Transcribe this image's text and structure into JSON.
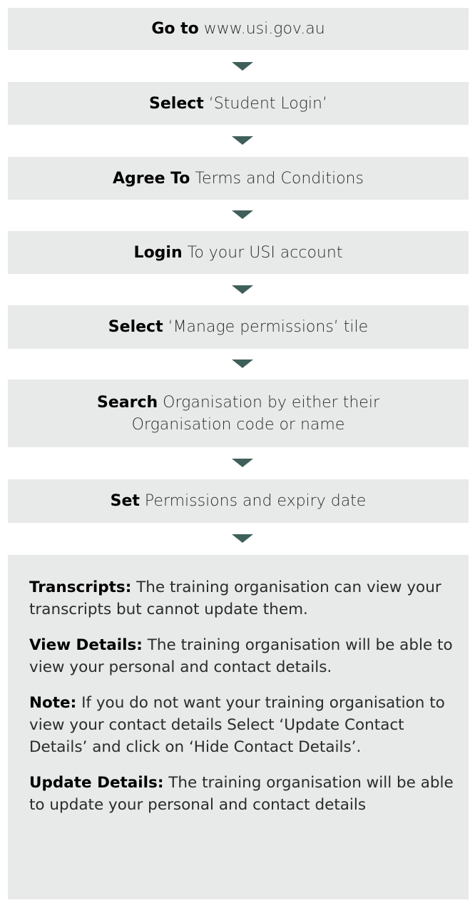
{
  "steps": [
    {
      "bold": "Go to",
      "rest": " www.usi.gov.au"
    },
    {
      "bold": "Select",
      "rest": " ‘Student Login’"
    },
    {
      "bold": "Agree To",
      "rest": " Terms and Conditions"
    },
    {
      "bold": "Login",
      "rest": " To your USI account"
    },
    {
      "bold": "Select",
      "rest": " ‘Manage permissions’ tile"
    },
    {
      "bold": "Search",
      "rest": " Organisation by either their Organisation code or name"
    },
    {
      "bold": "Set",
      "rest": " Permissions and expiry date"
    }
  ],
  "info": [
    {
      "bold": "Transcripts:",
      "rest": " The training organisation can view your transcripts but cannot update them."
    },
    {
      "bold": "View Details:",
      "rest": " The training organisation will be able to view your personal and contact details."
    },
    {
      "bold": "Note:",
      "rest": " If you do not want your training organisation to view your contact details Select ‘Update Contact Details’ and click on ‘Hide Contact Details’."
    },
    {
      "bold": "Update Details:",
      "rest": " The training organisation will be able to update your personal and contact details"
    }
  ],
  "colors": {
    "box_bg": "#e8e9e9",
    "arrow": "#3f5f5a"
  }
}
